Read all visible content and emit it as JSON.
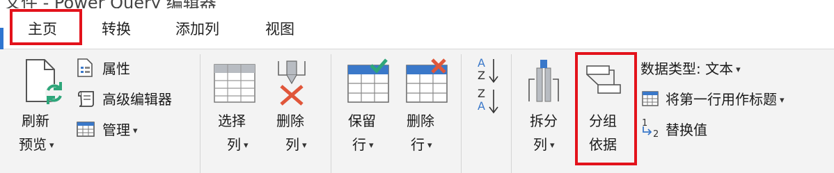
{
  "tabs": [
    "主页",
    "转换",
    "添加列",
    "视图"
  ],
  "caret": "▾",
  "query_group": {
    "refresh": {
      "line1": "刷新",
      "line2": "预览"
    },
    "properties": "属性",
    "advanced_editor": "高级编辑器",
    "manage": "管理"
  },
  "columns_group": {
    "choose": {
      "line1": "选择",
      "line2": "列"
    },
    "remove": {
      "line1": "删除",
      "line2": "列"
    }
  },
  "rows_group": {
    "keep": {
      "line1": "保留",
      "line2": "行"
    },
    "remove": {
      "line1": "删除",
      "line2": "行"
    }
  },
  "sort_group": {
    "asc": {
      "top": "A",
      "bottom": "Z"
    },
    "desc": {
      "top": "Z",
      "bottom": "A"
    }
  },
  "transform_group": {
    "split": {
      "line1": "拆分",
      "line2": "列"
    },
    "group_by": {
      "line1": "分组",
      "line2": "依据"
    },
    "data_type": "数据类型: 文本",
    "first_row_header": "将第一行用作标题",
    "replace_values": "替换值",
    "replace_values_icon_digits": {
      "top": "1",
      "bottom": "2"
    }
  },
  "colors": {
    "highlight": "#e3121b",
    "accent_blue": "#2e75d0",
    "check_green": "#2ea67a",
    "cross_red": "#e0563a"
  }
}
